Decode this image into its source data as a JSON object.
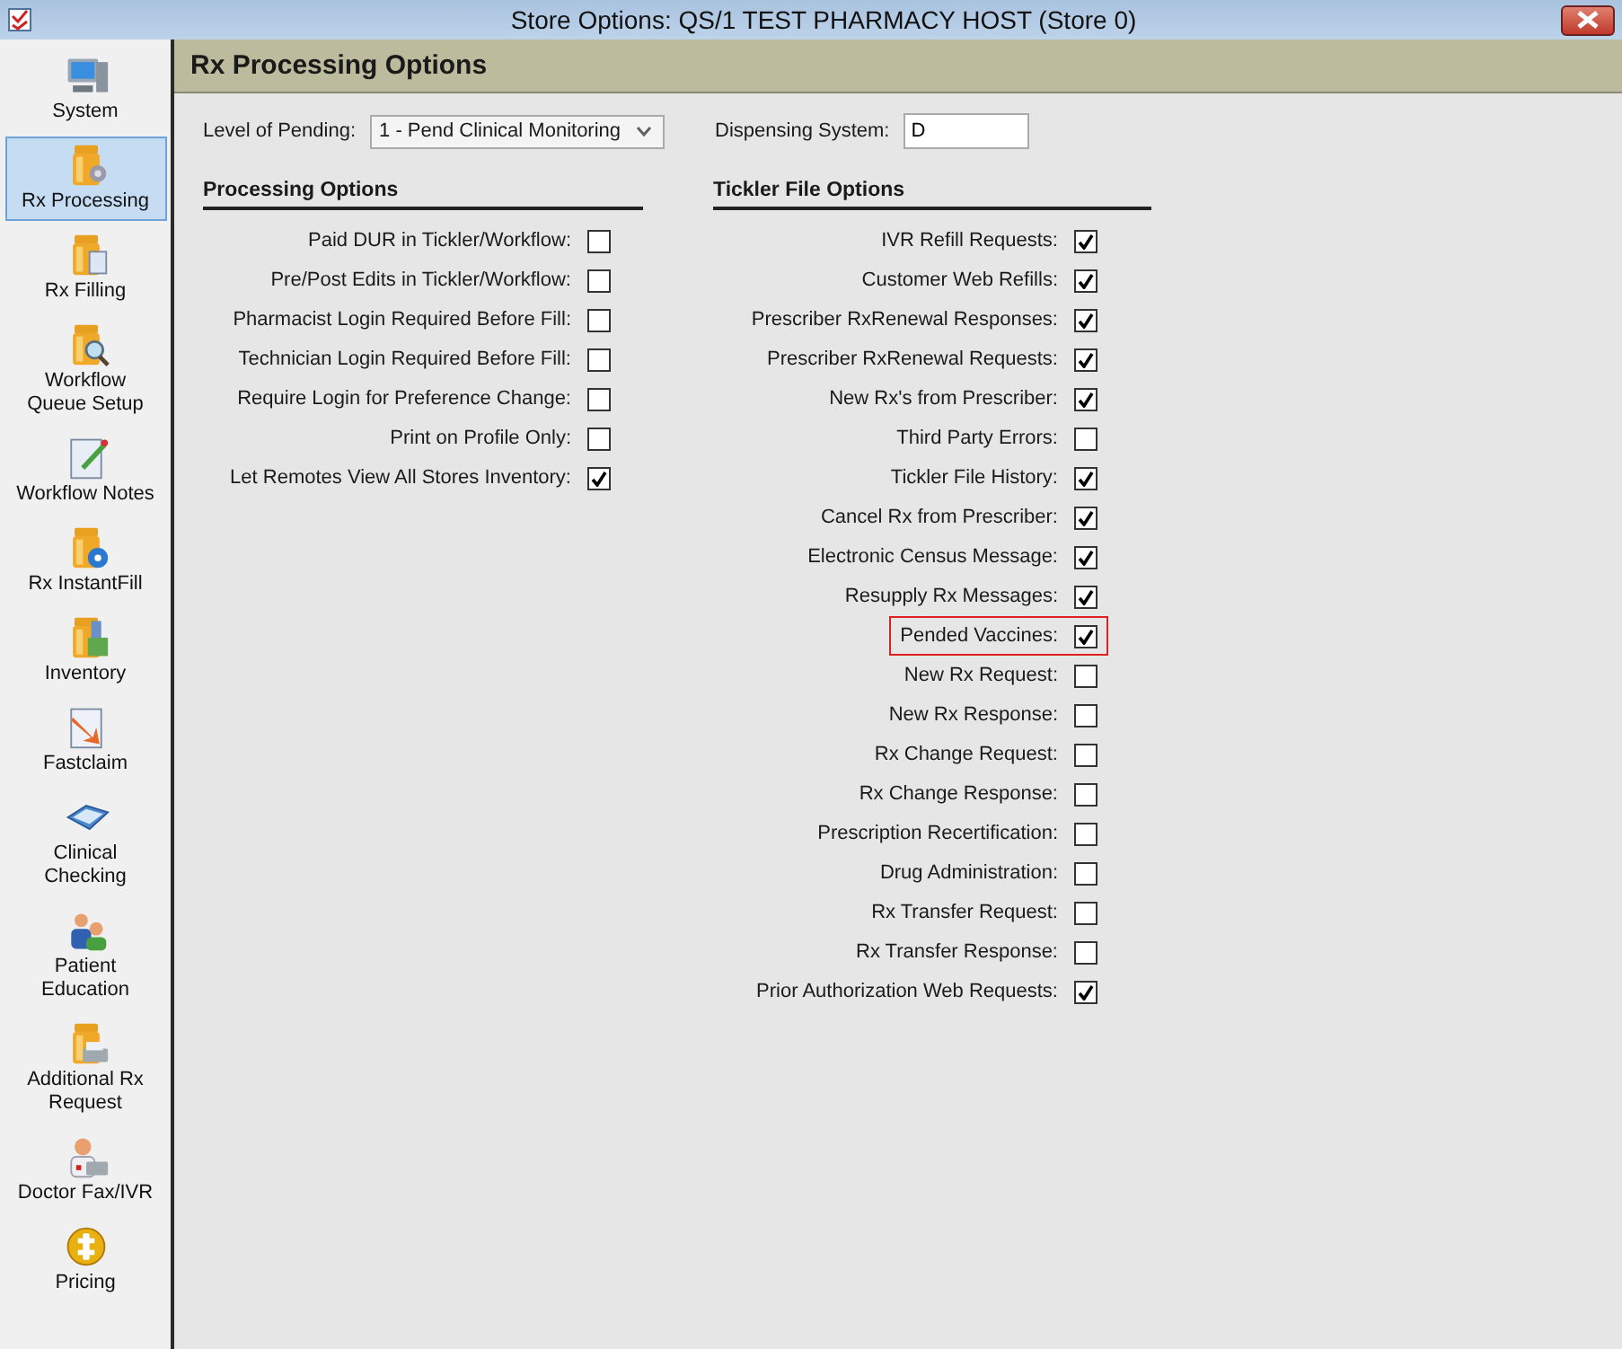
{
  "window": {
    "title": "Store Options: QS/1 TEST PHARMACY HOST (Store 0)"
  },
  "sidebar": {
    "items": [
      {
        "label": "System",
        "selected": false
      },
      {
        "label": "Rx Processing",
        "selected": true
      },
      {
        "label": "Rx Filling",
        "selected": false
      },
      {
        "label": "Workflow Queue Setup",
        "selected": false
      },
      {
        "label": "Workflow Notes",
        "selected": false
      },
      {
        "label": "Rx InstantFill",
        "selected": false
      },
      {
        "label": "Inventory",
        "selected": false
      },
      {
        "label": "Fastclaim",
        "selected": false
      },
      {
        "label": "Clinical Checking",
        "selected": false
      },
      {
        "label": "Patient Education",
        "selected": false
      },
      {
        "label": "Additional Rx Request",
        "selected": false
      },
      {
        "label": "Doctor Fax/IVR",
        "selected": false
      },
      {
        "label": "Pricing",
        "selected": false
      }
    ]
  },
  "panel": {
    "title": "Rx Processing Options",
    "level_of_pending": {
      "label": "Level of Pending:",
      "value": "1 - Pend Clinical Monitoring"
    },
    "dispensing_system": {
      "label": "Dispensing System:",
      "value": "D"
    },
    "processing_options": {
      "heading": "Processing Options",
      "items": [
        {
          "label": "Paid DUR in Tickler/Workflow:",
          "checked": false
        },
        {
          "label": "Pre/Post Edits in Tickler/Workflow:",
          "checked": false
        },
        {
          "label": "Pharmacist Login Required Before Fill:",
          "checked": false
        },
        {
          "label": "Technician Login Required Before Fill:",
          "checked": false
        },
        {
          "label": "Require Login for Preference Change:",
          "checked": false
        },
        {
          "label": "Print on Profile Only:",
          "checked": false
        },
        {
          "label": "Let Remotes View All Stores Inventory:",
          "checked": true
        }
      ]
    },
    "tickler_file_options": {
      "heading": "Tickler File Options",
      "items": [
        {
          "label": "IVR Refill Requests:",
          "checked": true,
          "highlighted": false
        },
        {
          "label": "Customer Web Refills:",
          "checked": true,
          "highlighted": false
        },
        {
          "label": "Prescriber RxRenewal Responses:",
          "checked": true,
          "highlighted": false
        },
        {
          "label": "Prescriber RxRenewal Requests:",
          "checked": true,
          "highlighted": false
        },
        {
          "label": "New Rx's from Prescriber:",
          "checked": true,
          "highlighted": false
        },
        {
          "label": "Third Party Errors:",
          "checked": false,
          "highlighted": false
        },
        {
          "label": "Tickler File History:",
          "checked": true,
          "highlighted": false
        },
        {
          "label": "Cancel Rx from Prescriber:",
          "checked": true,
          "highlighted": false
        },
        {
          "label": "Electronic Census Message:",
          "checked": true,
          "highlighted": false
        },
        {
          "label": "Resupply Rx Messages:",
          "checked": true,
          "highlighted": false
        },
        {
          "label": "Pended Vaccines:",
          "checked": true,
          "highlighted": true
        },
        {
          "label": "New Rx Request:",
          "checked": false,
          "highlighted": false
        },
        {
          "label": "New Rx Response:",
          "checked": false,
          "highlighted": false
        },
        {
          "label": "Rx Change Request:",
          "checked": false,
          "highlighted": false
        },
        {
          "label": "Rx Change Response:",
          "checked": false,
          "highlighted": false
        },
        {
          "label": "Prescription Recertification:",
          "checked": false,
          "highlighted": false
        },
        {
          "label": "Drug Administration:",
          "checked": false,
          "highlighted": false
        },
        {
          "label": "Rx Transfer Request:",
          "checked": false,
          "highlighted": false
        },
        {
          "label": "Rx Transfer Response:",
          "checked": false,
          "highlighted": false
        },
        {
          "label": "Prior Authorization Web Requests:",
          "checked": true,
          "highlighted": false
        }
      ]
    }
  }
}
